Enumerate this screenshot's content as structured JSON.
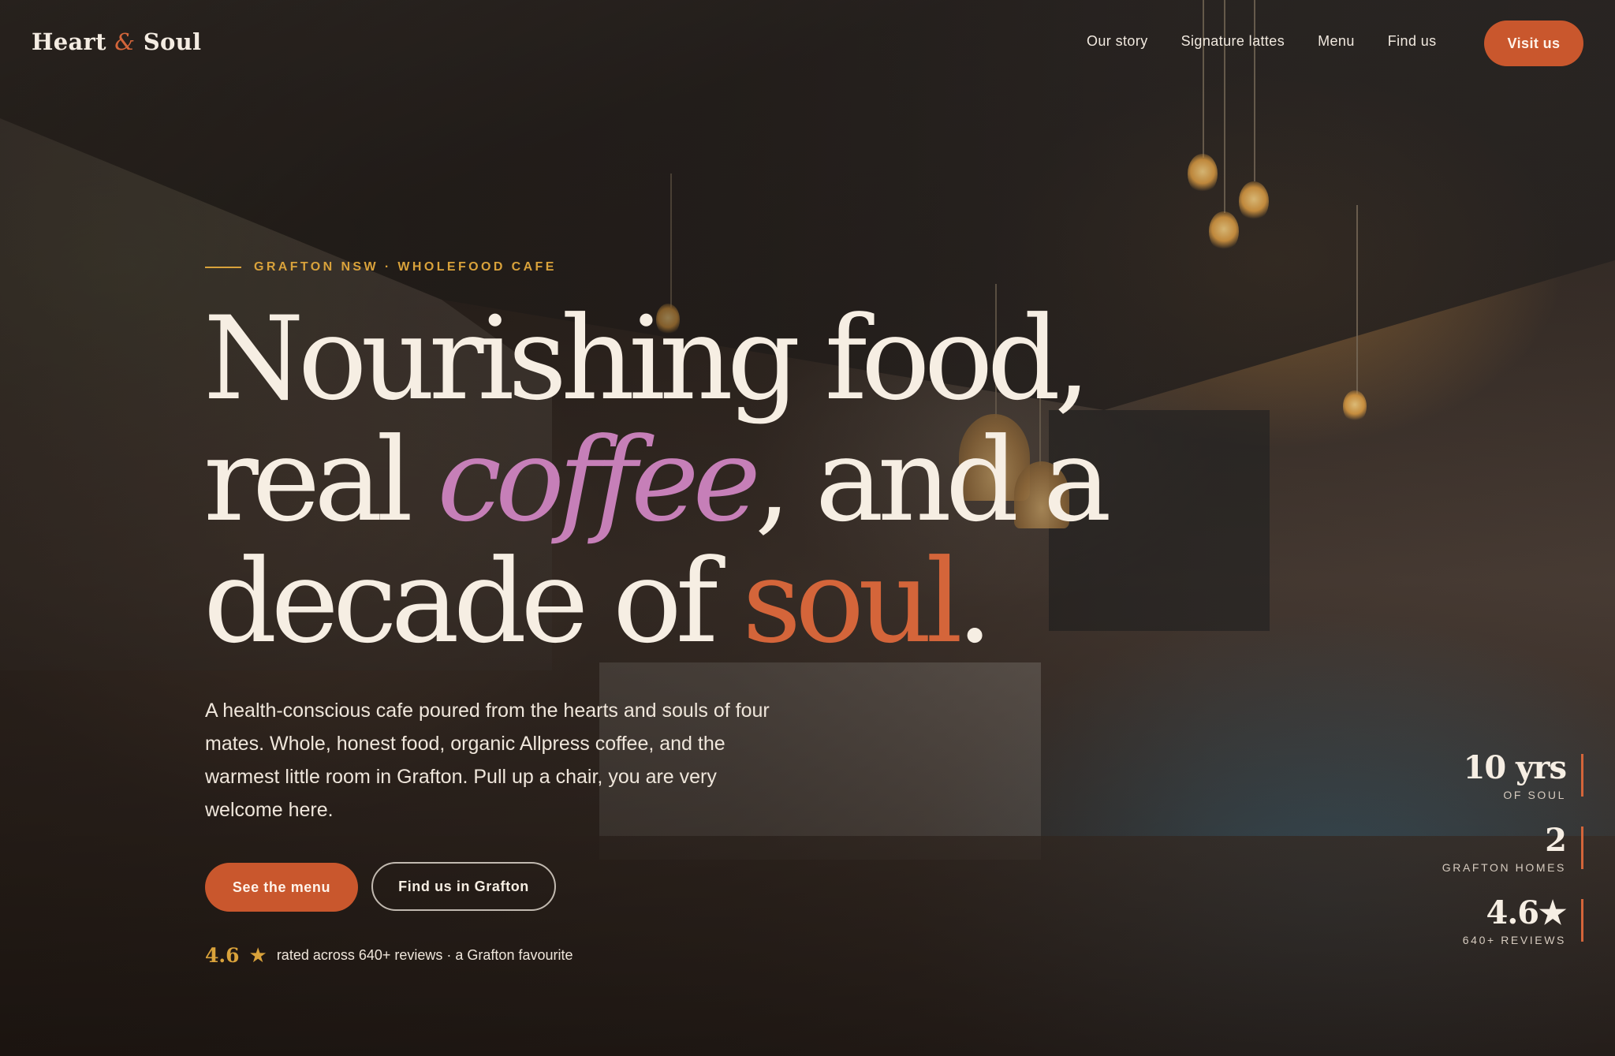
{
  "brand": {
    "name_part1": "Heart",
    "ampersand": "&",
    "name_part2": "Soul"
  },
  "nav": {
    "links": [
      "Our story",
      "Signature lattes",
      "Menu",
      "Find us"
    ],
    "cta": "Visit us"
  },
  "hero": {
    "eyebrow": "GRAFTON NSW · WHOLEFOOD CAFE",
    "headline": {
      "line1": "Nourishing food,",
      "line2_pre": "real ",
      "line2_accent": "coffee",
      "line2_post": ", and a",
      "line3_pre": "decade of ",
      "line3_accent": "soul",
      "line3_post": "."
    },
    "lede": "A health-conscious cafe poured from the hearts and souls of four mates. Whole, honest food, organic Allpress coffee, and the warmest little room in Grafton. Pull up a chair, you are very welcome here.",
    "primary_button": "See the menu",
    "secondary_button": "Find us in Grafton",
    "rating": {
      "score": "4.6",
      "star": "★",
      "text": "rated across 640+ reviews · a Grafton favourite"
    }
  },
  "stats": [
    {
      "value": "10 yrs",
      "label": "OF SOUL"
    },
    {
      "value": "2",
      "label": "GRAFTON HOMES"
    },
    {
      "value": "4.6★",
      "label": "640+ REVIEWS"
    }
  ],
  "colors": {
    "accent_orange": "#c9572d",
    "accent_gold": "#d9a23b",
    "accent_pink": "#c67fb8",
    "text_cream": "#f6eee3"
  },
  "icons": {
    "rating_icon": "star-icon"
  }
}
